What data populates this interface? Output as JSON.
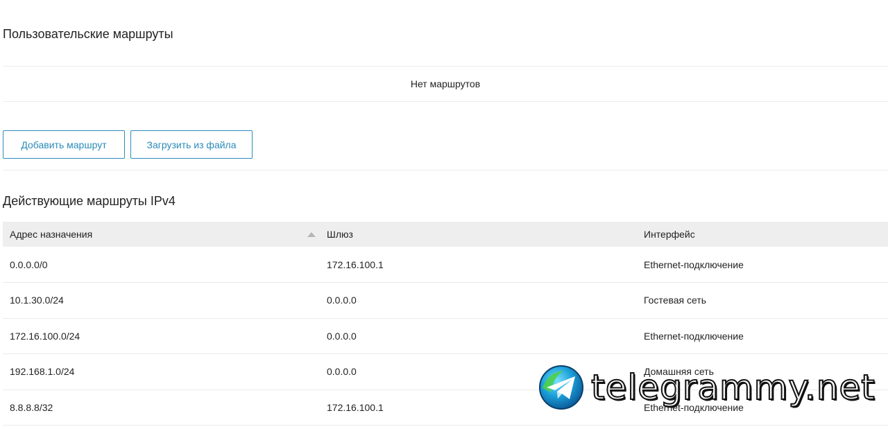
{
  "user_routes": {
    "title": "Пользовательские маршруты",
    "empty_text": "Нет маршрутов",
    "add_button": "Добавить маршрут",
    "load_button": "Загрузить из файла"
  },
  "active_routes": {
    "title": "Действующие маршруты IPv4",
    "columns": [
      "Адрес назначения",
      "Шлюз",
      "Интерфейс"
    ],
    "sort_column": "Адрес назначения",
    "rows": [
      {
        "dest": "0.0.0.0/0",
        "gateway": "172.16.100.1",
        "iface": "Ethernet-подключение"
      },
      {
        "dest": "10.1.30.0/24",
        "gateway": "0.0.0.0",
        "iface": "Гостевая сеть"
      },
      {
        "dest": "172.16.100.0/24",
        "gateway": "0.0.0.0",
        "iface": "Ethernet-подключение"
      },
      {
        "dest": "192.168.1.0/24",
        "gateway": "0.0.0.0",
        "iface": "Домашняя сеть"
      },
      {
        "dest": "8.8.8.8/32",
        "gateway": "172.16.100.1",
        "iface": "Ethernet-подключение"
      }
    ]
  },
  "watermark": {
    "text": "telegrammy.net",
    "icon": "telegram-plane-icon"
  },
  "colors": {
    "accent": "#2a8bb8",
    "header_bg": "#eeeeee",
    "divider": "#ececec"
  }
}
